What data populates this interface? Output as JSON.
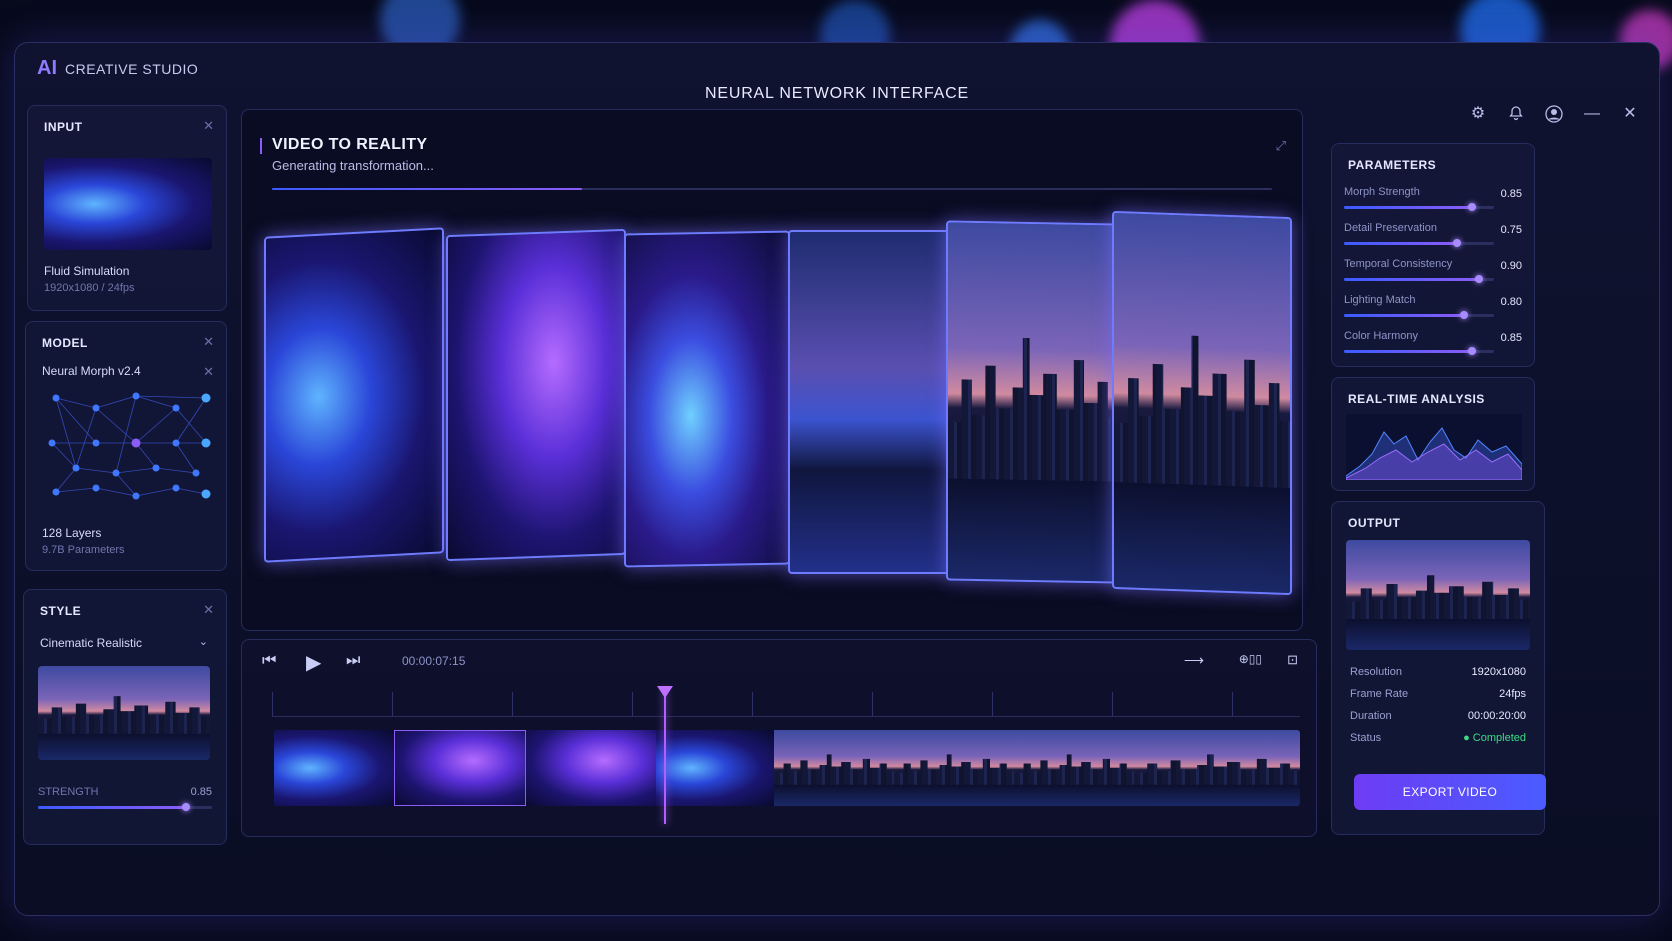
{
  "app": {
    "logo": "AI",
    "name": "CREATIVE STUDIO",
    "title": "NEURAL NETWORK INTERFACE"
  },
  "window_controls": [
    {
      "name": "settings-icon",
      "glyph": "⚙"
    },
    {
      "name": "bell-icon",
      "glyph": "🔔"
    },
    {
      "name": "user-icon",
      "glyph": "◉"
    },
    {
      "name": "minimize-icon",
      "glyph": "—"
    },
    {
      "name": "close-icon",
      "glyph": "✕"
    }
  ],
  "input": {
    "header": "INPUT",
    "name": "Fluid Simulation",
    "meta": "1920x1080 / 24fps"
  },
  "model": {
    "header": "MODEL",
    "name": "Neural Morph v2.4",
    "layers": "128 Layers",
    "params": "9.7B Parameters"
  },
  "style": {
    "header": "STYLE",
    "selected": "Cinematic Realistic",
    "strength_label": "STRENGTH",
    "strength_value": "0.85",
    "strength": 0.85
  },
  "main": {
    "title": "VIDEO TO REALITY",
    "subtitle": "Generating transformation...",
    "progress": 0.31
  },
  "timeline": {
    "time": "00:00:07:15",
    "playhead": 0.38
  },
  "parameters": {
    "header": "PARAMETERS",
    "items": [
      {
        "label": "Morph Strength",
        "value": "0.85",
        "fill": 0.85
      },
      {
        "label": "Detail Preservation",
        "value": "0.75",
        "fill": 0.75
      },
      {
        "label": "Temporal Consistency",
        "value": "0.90",
        "fill": 0.9
      },
      {
        "label": "Lighting Match",
        "value": "0.80",
        "fill": 0.8
      },
      {
        "label": "Color Harmony",
        "value": "0.85",
        "fill": 0.85
      }
    ]
  },
  "analysis": {
    "header": "REAL-TIME ANALYSIS"
  },
  "output": {
    "header": "OUTPUT",
    "rows": [
      {
        "label": "Resolution",
        "value": "1920x1080"
      },
      {
        "label": "Frame Rate",
        "value": "24fps"
      },
      {
        "label": "Duration",
        "value": "00:00:20:00"
      },
      {
        "label": "Status",
        "value": "● Completed"
      }
    ],
    "export_label": "EXPORT VIDEO",
    "status_color": "#3ddc84"
  },
  "colors": {
    "accent": "#8b5cf6",
    "blue": "#3b5bff"
  }
}
